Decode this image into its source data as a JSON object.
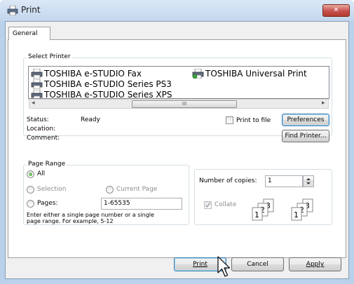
{
  "window": {
    "title": "Print",
    "close_glyph": "✕"
  },
  "tab": {
    "label": "General"
  },
  "select_printer": {
    "legend": "Select Printer",
    "printers": [
      {
        "name": "TOSHIBA e-STUDIO Fax",
        "icon": "printer-icon"
      },
      {
        "name": "TOSHIBA e-STUDIO Series PS3",
        "icon": "printer-icon"
      },
      {
        "name": "TOSHIBA e-STUDIO Series XPS",
        "icon": "printer-icon"
      },
      {
        "name": "TOSHIBA Universal Print",
        "icon": "network-printer-icon",
        "selected": true
      }
    ],
    "scroll": {
      "left_glyph": "◂",
      "right_glyph": "▸",
      "grip": "III"
    },
    "status_label": "Status:",
    "status_value": "Ready",
    "location_label": "Location:",
    "comment_label": "Comment:",
    "print_to_file": {
      "label": "Print to file",
      "checked": false
    },
    "preferences_label": "Preferences",
    "find_printer_label": "Find Printer..."
  },
  "page_range": {
    "legend": "Page Range",
    "all_label": "All",
    "selection_label": "Selection",
    "current_page_label": "Current Page",
    "pages_label": "Pages:",
    "pages_value": "1-65535",
    "hint_line1": "Enter either a single page number or a single",
    "hint_line2": "page range.  For example, 5-12",
    "selected": "all"
  },
  "copies": {
    "label": "Number of copies:",
    "value": "1",
    "collate_label": "Collate",
    "collate_checked": true
  },
  "buttons": {
    "print": "Print",
    "cancel": "Cancel",
    "apply": "Apply"
  },
  "colors": {
    "accent": "#3c7fb1",
    "frame": "#b9d1ea",
    "close": "#c75050"
  }
}
